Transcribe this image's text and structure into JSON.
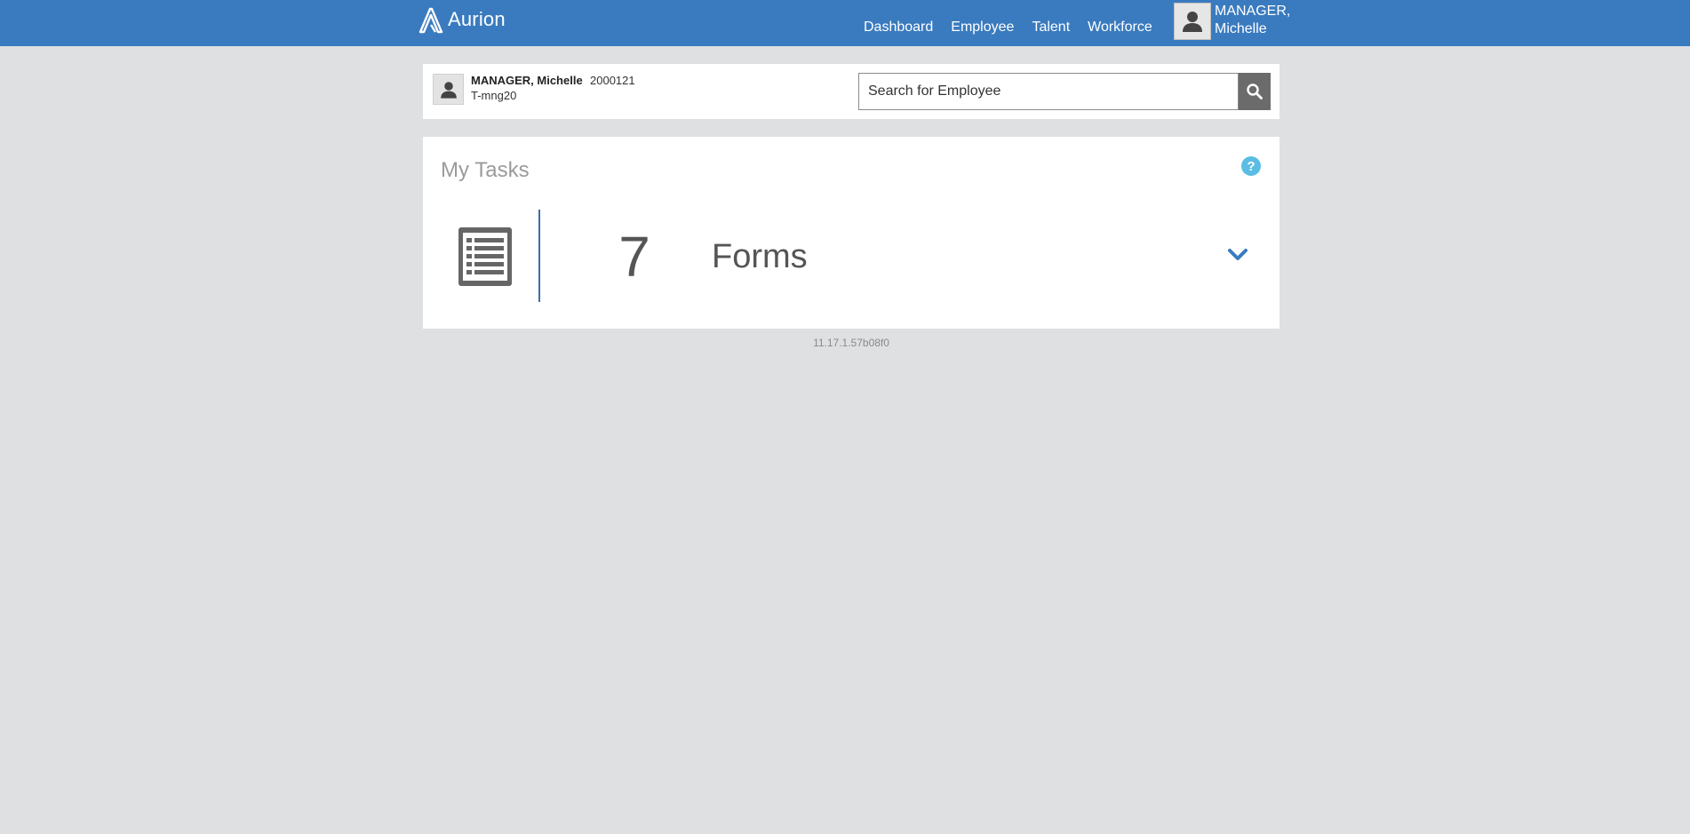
{
  "app": {
    "logo_text": "Aurion"
  },
  "nav": {
    "items": [
      "Dashboard",
      "Employee",
      "Talent",
      "Workforce"
    ]
  },
  "user_menu": {
    "name_line1": "MANAGER,",
    "name_line2": "Michelle",
    "icon": "user-avatar-icon"
  },
  "employee": {
    "name": "MANAGER, Michelle",
    "number": "2000121",
    "username": "T-mng20"
  },
  "search": {
    "placeholder": "Search for Employee",
    "icon": "search-icon"
  },
  "tasks": {
    "title": "My Tasks",
    "help_icon": "?",
    "items": [
      {
        "count": "7",
        "label": "Forms",
        "icon": "list-document-icon"
      }
    ]
  },
  "footer": {
    "version": "11.17.1.57b08f0"
  },
  "colors": {
    "header": "#3a7bbf",
    "background": "#dfe0e2",
    "help": "#5bbde3",
    "accent": "#3a6fa8"
  }
}
